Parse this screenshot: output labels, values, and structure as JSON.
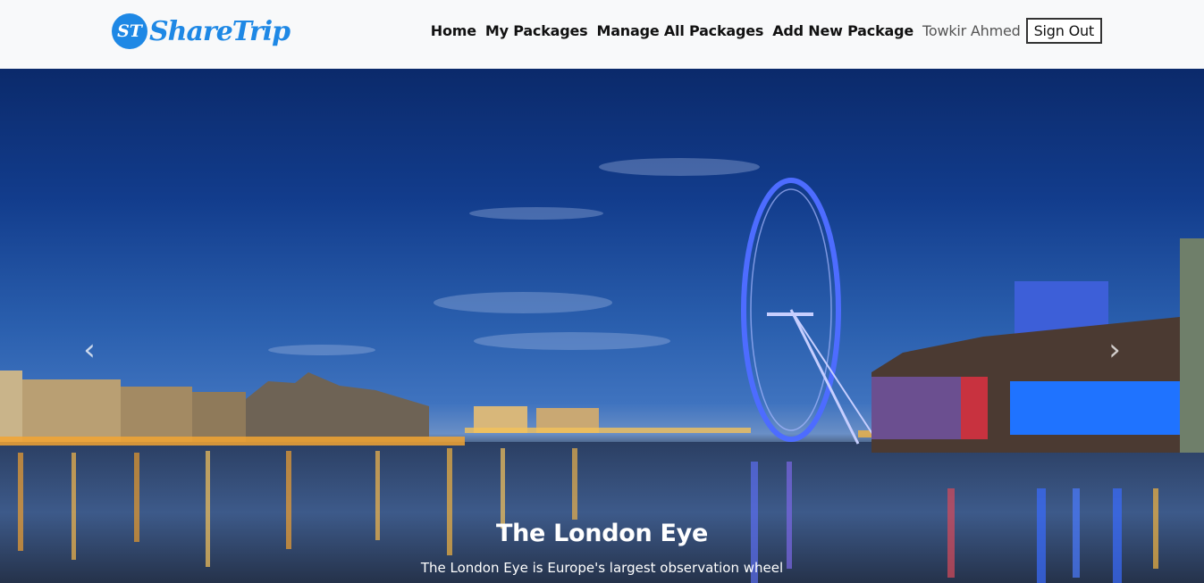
{
  "brand": {
    "badge": "ST",
    "name": "ShareTrip",
    "color": "#1e88e5"
  },
  "nav": {
    "home": "Home",
    "my_packages": "My Packages",
    "manage_packages": "Manage All Packages",
    "add_package": "Add New Package",
    "user_name": "Towkir Ahmed",
    "sign_out": "Sign Out"
  },
  "carousel": {
    "prev_icon": "chevron-left-icon",
    "next_icon": "chevron-right-icon",
    "slide": {
      "title": "The London Eye",
      "text": "The London Eye is Europe's largest observation wheel"
    }
  }
}
